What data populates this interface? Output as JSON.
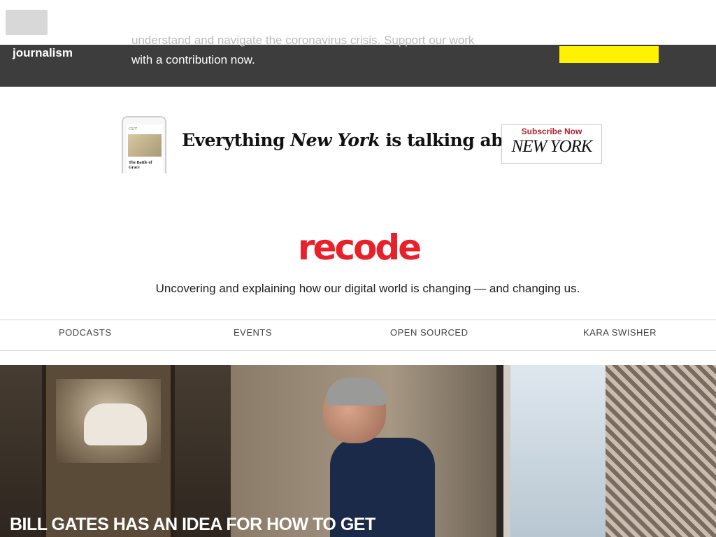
{
  "banner": {
    "journalism_label": "journalism",
    "text_line1": "understand and navigate the coronavirus crisis. Support our work",
    "text_line2": "with a contribution now."
  },
  "ad": {
    "phone_section": "CUT",
    "phone_caption": "The Battle of Grace",
    "tagline_before": "Everything ",
    "tagline_brand": "New York",
    "tagline_after": " is talking about.",
    "subscribe_label": "Subscribe Now",
    "subscribe_brand": "NEW YORK"
  },
  "header": {
    "logo_text": "recode",
    "tagline": "Uncovering and explaining how our digital world is changing — and changing us."
  },
  "nav": {
    "items": [
      "PODCASTS",
      "EVENTS",
      "OPEN SOURCED",
      "KARA SWISHER"
    ]
  },
  "hero": {
    "heading": "BILL GATES HAS AN IDEA FOR HOW TO GET"
  },
  "colors": {
    "brand_red": "#e9202a",
    "contribute_yellow": "#fff200",
    "banner_dark": "#3d3d3d"
  }
}
